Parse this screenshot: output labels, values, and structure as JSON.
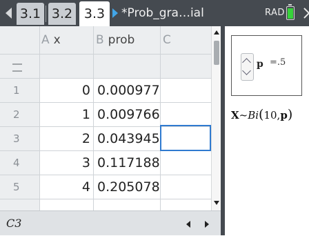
{
  "tabs": [
    {
      "label": "3.1",
      "active": false
    },
    {
      "label": "3.2",
      "active": false
    },
    {
      "label": "3.3",
      "active": true
    }
  ],
  "document_title": "*Prob_gra…ial",
  "angle_mode": "RAD",
  "battery_color": "#37d23a",
  "spreadsheet": {
    "columns": [
      {
        "letter": "A",
        "name": "x"
      },
      {
        "letter": "B",
        "name": "prob"
      },
      {
        "letter": "C",
        "name": ""
      }
    ],
    "formula_row_icon": "equals-icon",
    "rows": [
      {
        "num": "1",
        "x": "0",
        "prob": "0.000977"
      },
      {
        "num": "2",
        "x": "1",
        "prob": "0.009766"
      },
      {
        "num": "3",
        "x": "2",
        "prob": "0.043945"
      },
      {
        "num": "4",
        "x": "3",
        "prob": "0.117188"
      },
      {
        "num": "5",
        "x": "4",
        "prob": "0.205078"
      }
    ],
    "selected_cell": "C3",
    "selection_color": "#2f7ad0"
  },
  "notes": {
    "slider": {
      "variable": "p",
      "value": "=.5"
    },
    "expression": {
      "lhs": "X",
      "tilde": "~",
      "func": "Bi",
      "arg1": "10,",
      "arg2": "p"
    }
  }
}
